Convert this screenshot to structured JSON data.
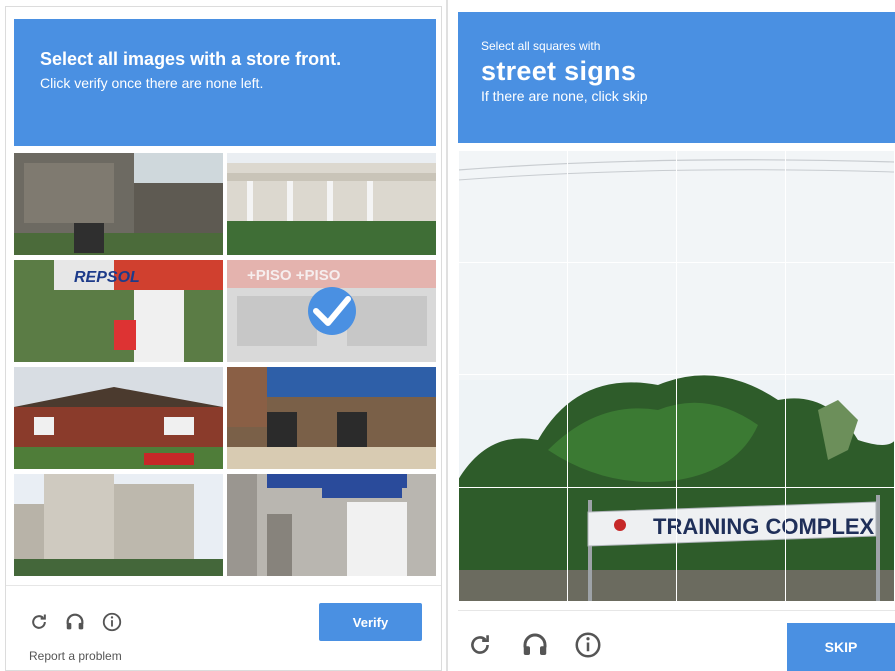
{
  "left_captcha": {
    "header": {
      "instruction_prefix": "Select all images with a",
      "instruction_target": "store front.",
      "subtext": "Click verify once there are none left."
    },
    "tiles": [
      {
        "name": "stone-ruins",
        "selected": false
      },
      {
        "name": "white-veranda-house",
        "selected": false
      },
      {
        "name": "repsol-station",
        "selected": false
      },
      {
        "name": "piso-storefront",
        "selected": true
      },
      {
        "name": "brick-house",
        "selected": false
      },
      {
        "name": "stone-arches",
        "selected": false
      },
      {
        "name": "apartment-tower",
        "selected": false
      },
      {
        "name": "barbershop-storefront",
        "selected": false
      }
    ],
    "footer": {
      "reload_icon": "reload-icon",
      "audio_icon": "headphones-icon",
      "info_icon": "info-icon",
      "verify_label": "Verify",
      "report_label": "Report a problem"
    },
    "tile_text": {
      "repsol": "REPSOL",
      "piso": "+PISO +PISO"
    },
    "accent": "#4a90e2"
  },
  "right_captcha": {
    "header": {
      "small_text": "Select all squares with",
      "target": "street signs",
      "hint": "If there are none, click skip"
    },
    "grid": {
      "rows": 4,
      "cols": 4,
      "selected_cells": []
    },
    "sign_text": "TRAINING COMPLEX",
    "footer": {
      "reload_icon": "reload-icon",
      "audio_icon": "headphones-icon",
      "info_icon": "info-icon",
      "skip_label": "SKIP"
    },
    "accent": "#4a90e2"
  }
}
